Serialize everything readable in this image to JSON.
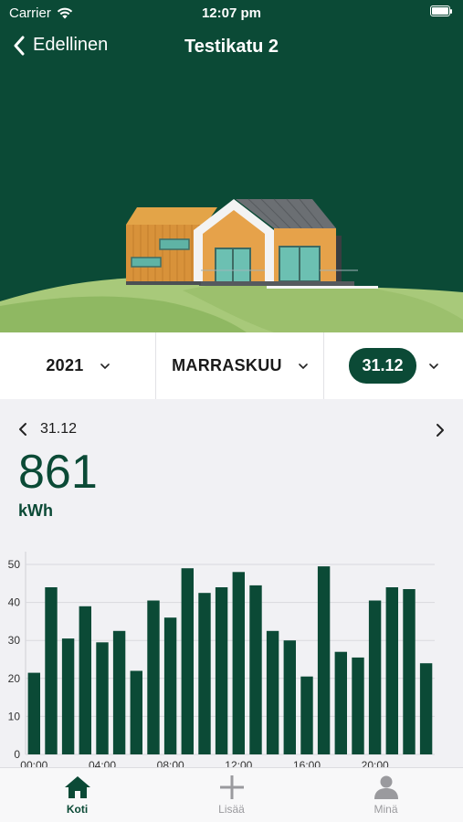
{
  "status_bar": {
    "carrier": "Carrier",
    "time": "12:07 pm"
  },
  "nav": {
    "back_label": "Edellinen",
    "title": "Testikatu 2"
  },
  "selectors": {
    "year": "2021",
    "month": "MARRASKUU",
    "day": "31.12"
  },
  "summary": {
    "date": "31.12",
    "value": "861",
    "unit": "kWh"
  },
  "chart_data": {
    "type": "bar",
    "x": [
      "00:00",
      "01:00",
      "02:00",
      "03:00",
      "04:00",
      "05:00",
      "06:00",
      "07:00",
      "08:00",
      "09:00",
      "10:00",
      "11:00",
      "12:00",
      "13:00",
      "14:00",
      "15:00",
      "16:00",
      "17:00",
      "18:00",
      "19:00",
      "20:00",
      "21:00",
      "22:00",
      "23:00"
    ],
    "values": [
      21.5,
      44,
      30.5,
      39,
      29.5,
      32.5,
      22,
      40.5,
      36,
      49,
      42.5,
      44,
      48,
      44.5,
      32.5,
      30,
      20.5,
      49.5,
      27,
      25.5,
      40.5,
      44,
      43.5,
      24
    ],
    "xtick_labels": [
      "00:00",
      "04:00",
      "08:00",
      "12:00",
      "16:00",
      "20:00"
    ],
    "yticks": [
      "0",
      "10",
      "20",
      "30",
      "40",
      "50"
    ],
    "ylim": [
      0,
      50
    ],
    "grid": true,
    "bar_color": "#0b4a36"
  },
  "tabs": [
    {
      "label": "Koti",
      "icon": "home-icon",
      "active": true
    },
    {
      "label": "Lisää",
      "icon": "plus-icon",
      "active": false
    },
    {
      "label": "Minä",
      "icon": "person-icon",
      "active": false
    }
  ],
  "colors": {
    "brand": "#0b4a36",
    "hill_light": "#a8c97a",
    "hill_dark": "#8fb862"
  }
}
